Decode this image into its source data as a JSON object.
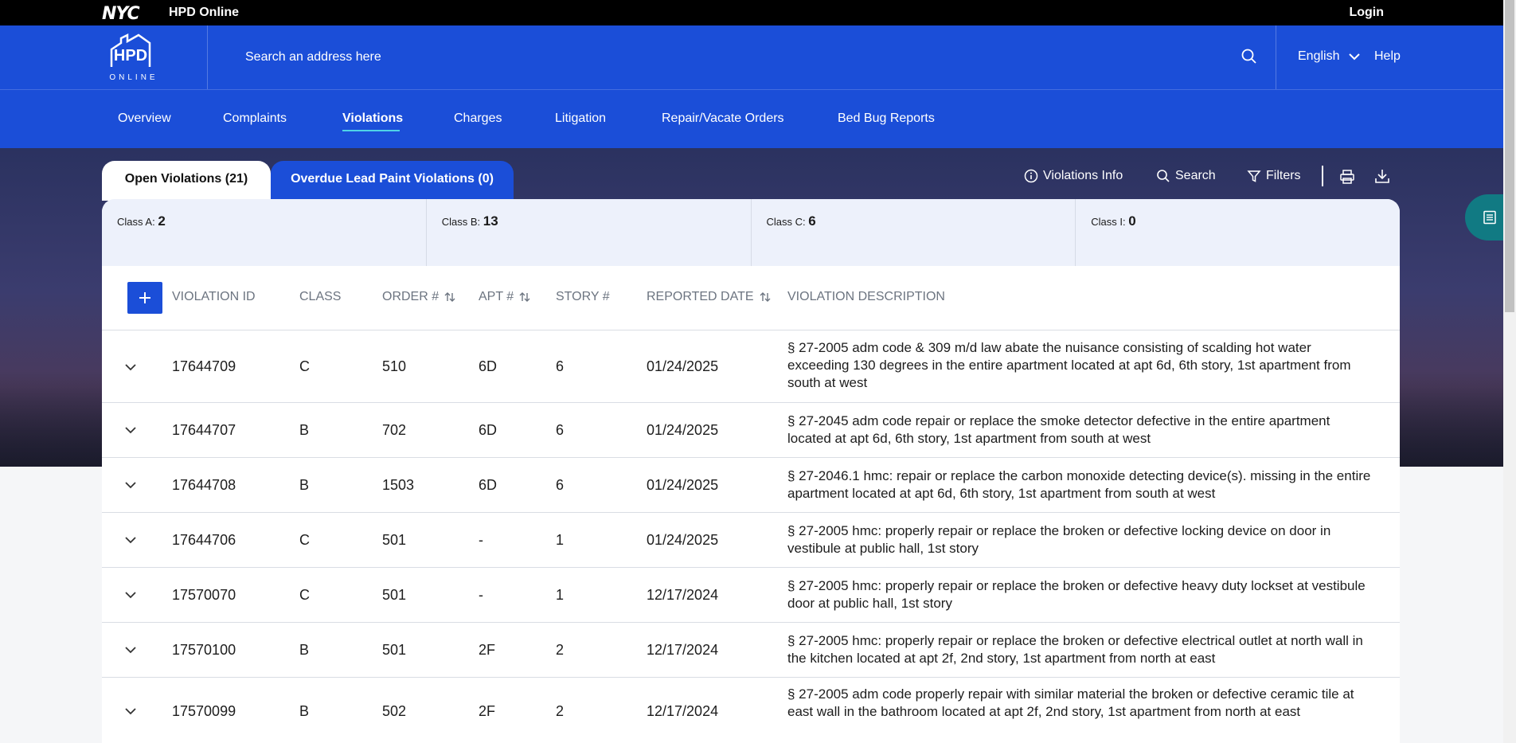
{
  "topbar": {
    "nyc": "NYC",
    "brand": "HPD Online",
    "login": "Login"
  },
  "header": {
    "logo_text_1": "HPD",
    "logo_text_2": "ONLINE",
    "search_placeholder": "Search an address here",
    "language": "English",
    "help": "Help"
  },
  "nav": [
    {
      "label": "Overview"
    },
    {
      "label": "Complaints"
    },
    {
      "label": "Violations"
    },
    {
      "label": "Charges"
    },
    {
      "label": "Litigation"
    },
    {
      "label": "Repair/Vacate Orders"
    },
    {
      "label": "Bed Bug Reports"
    }
  ],
  "tabs": {
    "open": "Open Violations (21)",
    "lead": "Overdue Lead Paint Violations (0)"
  },
  "tools": {
    "info": "Violations Info",
    "search": "Search",
    "filters": "Filters"
  },
  "classes": [
    {
      "label": "Class A:",
      "count": "2"
    },
    {
      "label": "Class B:",
      "count": "13"
    },
    {
      "label": "Class C:",
      "count": "6"
    },
    {
      "label": "Class I:",
      "count": "0"
    }
  ],
  "columns": {
    "id": "VIOLATION ID",
    "class": "CLASS",
    "order": "ORDER #",
    "apt": "APT #",
    "story": "STORY #",
    "date": "REPORTED DATE",
    "desc": "VIOLATION DESCRIPTION"
  },
  "rows": [
    {
      "id": "17644709",
      "cls": "C",
      "order": "510",
      "apt": "6D",
      "story": "6",
      "date": "01/24/2025",
      "desc": "§ 27-2005 adm code & 309 m/d law abate the nuisance consisting of scalding hot water exceeding 130 degrees in the entire apartment located at apt 6d, 6th story, 1st apartment from south at west"
    },
    {
      "id": "17644707",
      "cls": "B",
      "order": "702",
      "apt": "6D",
      "story": "6",
      "date": "01/24/2025",
      "desc": "§ 27-2045 adm code repair or replace the smoke detector defective in the entire apartment located at apt 6d, 6th story, 1st apartment from south at west"
    },
    {
      "id": "17644708",
      "cls": "B",
      "order": "1503",
      "apt": "6D",
      "story": "6",
      "date": "01/24/2025",
      "desc": "§ 27-2046.1 hmc: repair or replace the carbon monoxide detecting device(s). missing in the entire apartment located at apt 6d, 6th story, 1st apartment from south at west"
    },
    {
      "id": "17644706",
      "cls": "C",
      "order": "501",
      "apt": "-",
      "story": "1",
      "date": "01/24/2025",
      "desc": "§ 27-2005 hmc: properly repair or replace the broken or defective locking device on door in vestibule at public hall, 1st story"
    },
    {
      "id": "17570070",
      "cls": "C",
      "order": "501",
      "apt": "-",
      "story": "1",
      "date": "12/17/2024",
      "desc": "§ 27-2005 hmc: properly repair or replace the broken or defective heavy duty lockset at vestibule door at public hall, 1st story"
    },
    {
      "id": "17570100",
      "cls": "B",
      "order": "501",
      "apt": "2F",
      "story": "2",
      "date": "12/17/2024",
      "desc": "§ 27-2005 hmc: properly repair or replace the broken or defective electrical outlet at north wall in the kitchen located at apt 2f, 2nd story, 1st apartment from north at east"
    },
    {
      "id": "17570099",
      "cls": "B",
      "order": "502",
      "apt": "2F",
      "story": "2",
      "date": "12/17/2024",
      "desc": "§ 27-2005 adm code properly repair with similar material the broken or defective ceramic tile at east wall in the bathroom located at apt 2f, 2nd story, 1st apartment from north at east"
    }
  ]
}
